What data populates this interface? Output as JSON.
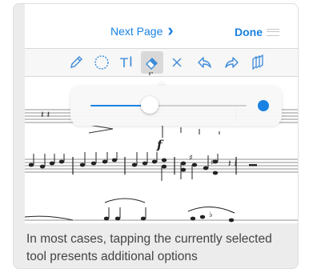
{
  "navbar": {
    "next_page_label": "Next Page",
    "next_page_icon": "chevron-right-icon",
    "done_label": "Done",
    "menu_icon": "hamburger-grip-icon"
  },
  "toolbar": {
    "tools": [
      {
        "name": "pencil",
        "icon": "pencil-icon"
      },
      {
        "name": "shape",
        "icon": "circle-icon"
      },
      {
        "name": "text",
        "icon": "text-tool-icon",
        "label": "T"
      },
      {
        "name": "eraser",
        "icon": "eraser-icon",
        "selected": true
      },
      {
        "name": "clear",
        "icon": "close-icon"
      },
      {
        "name": "undo",
        "icon": "undo-icon"
      },
      {
        "name": "redo",
        "icon": "redo-icon"
      },
      {
        "name": "layers",
        "icon": "layers-icon"
      }
    ],
    "accent_color": "#3c8bd9"
  },
  "popover": {
    "slider_value": 0.38,
    "accent_color": "#1a82e2",
    "size_preview_icon": "brush-size-dot-icon"
  },
  "score": {
    "dynamic_marking": "f"
  },
  "caption": "In most cases, tapping the currently selected tool presents additional options"
}
